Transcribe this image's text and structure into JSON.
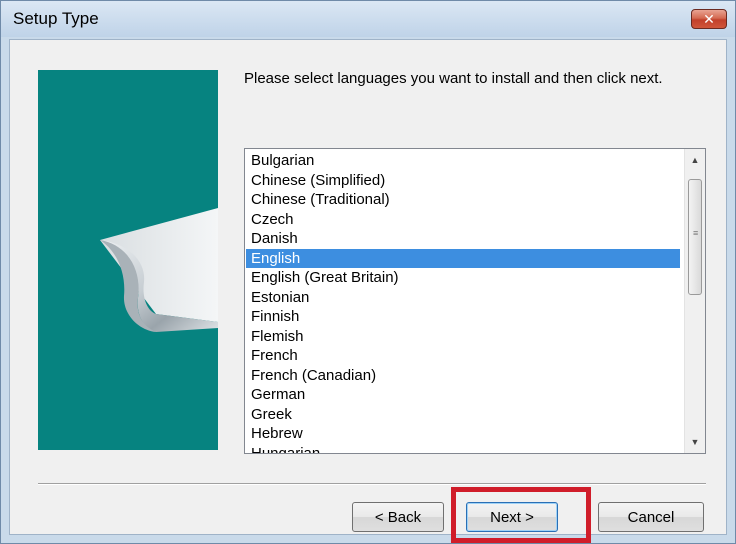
{
  "window": {
    "title": "Setup Type",
    "close_glyph": "✕"
  },
  "instruction": "Please select languages you want to install and then click next.",
  "language_list": {
    "items": [
      "Bulgarian",
      "Chinese (Simplified)",
      "Chinese (Traditional)",
      "Czech",
      "Danish",
      "English",
      "English (Great Britain)",
      "Estonian",
      "Finnish",
      "Flemish",
      "French",
      "French (Canadian)",
      "German",
      "Greek",
      "Hebrew",
      "Hungarian"
    ],
    "selected": "English",
    "scroll_up_glyph": "▲",
    "scroll_down_glyph": "▼"
  },
  "buttons": {
    "back": "< Back",
    "next": "Next >",
    "cancel": "Cancel"
  },
  "colors": {
    "side_panel": "#068380",
    "selection": "#3d8ee0",
    "highlight_box": "#d01d2a"
  }
}
